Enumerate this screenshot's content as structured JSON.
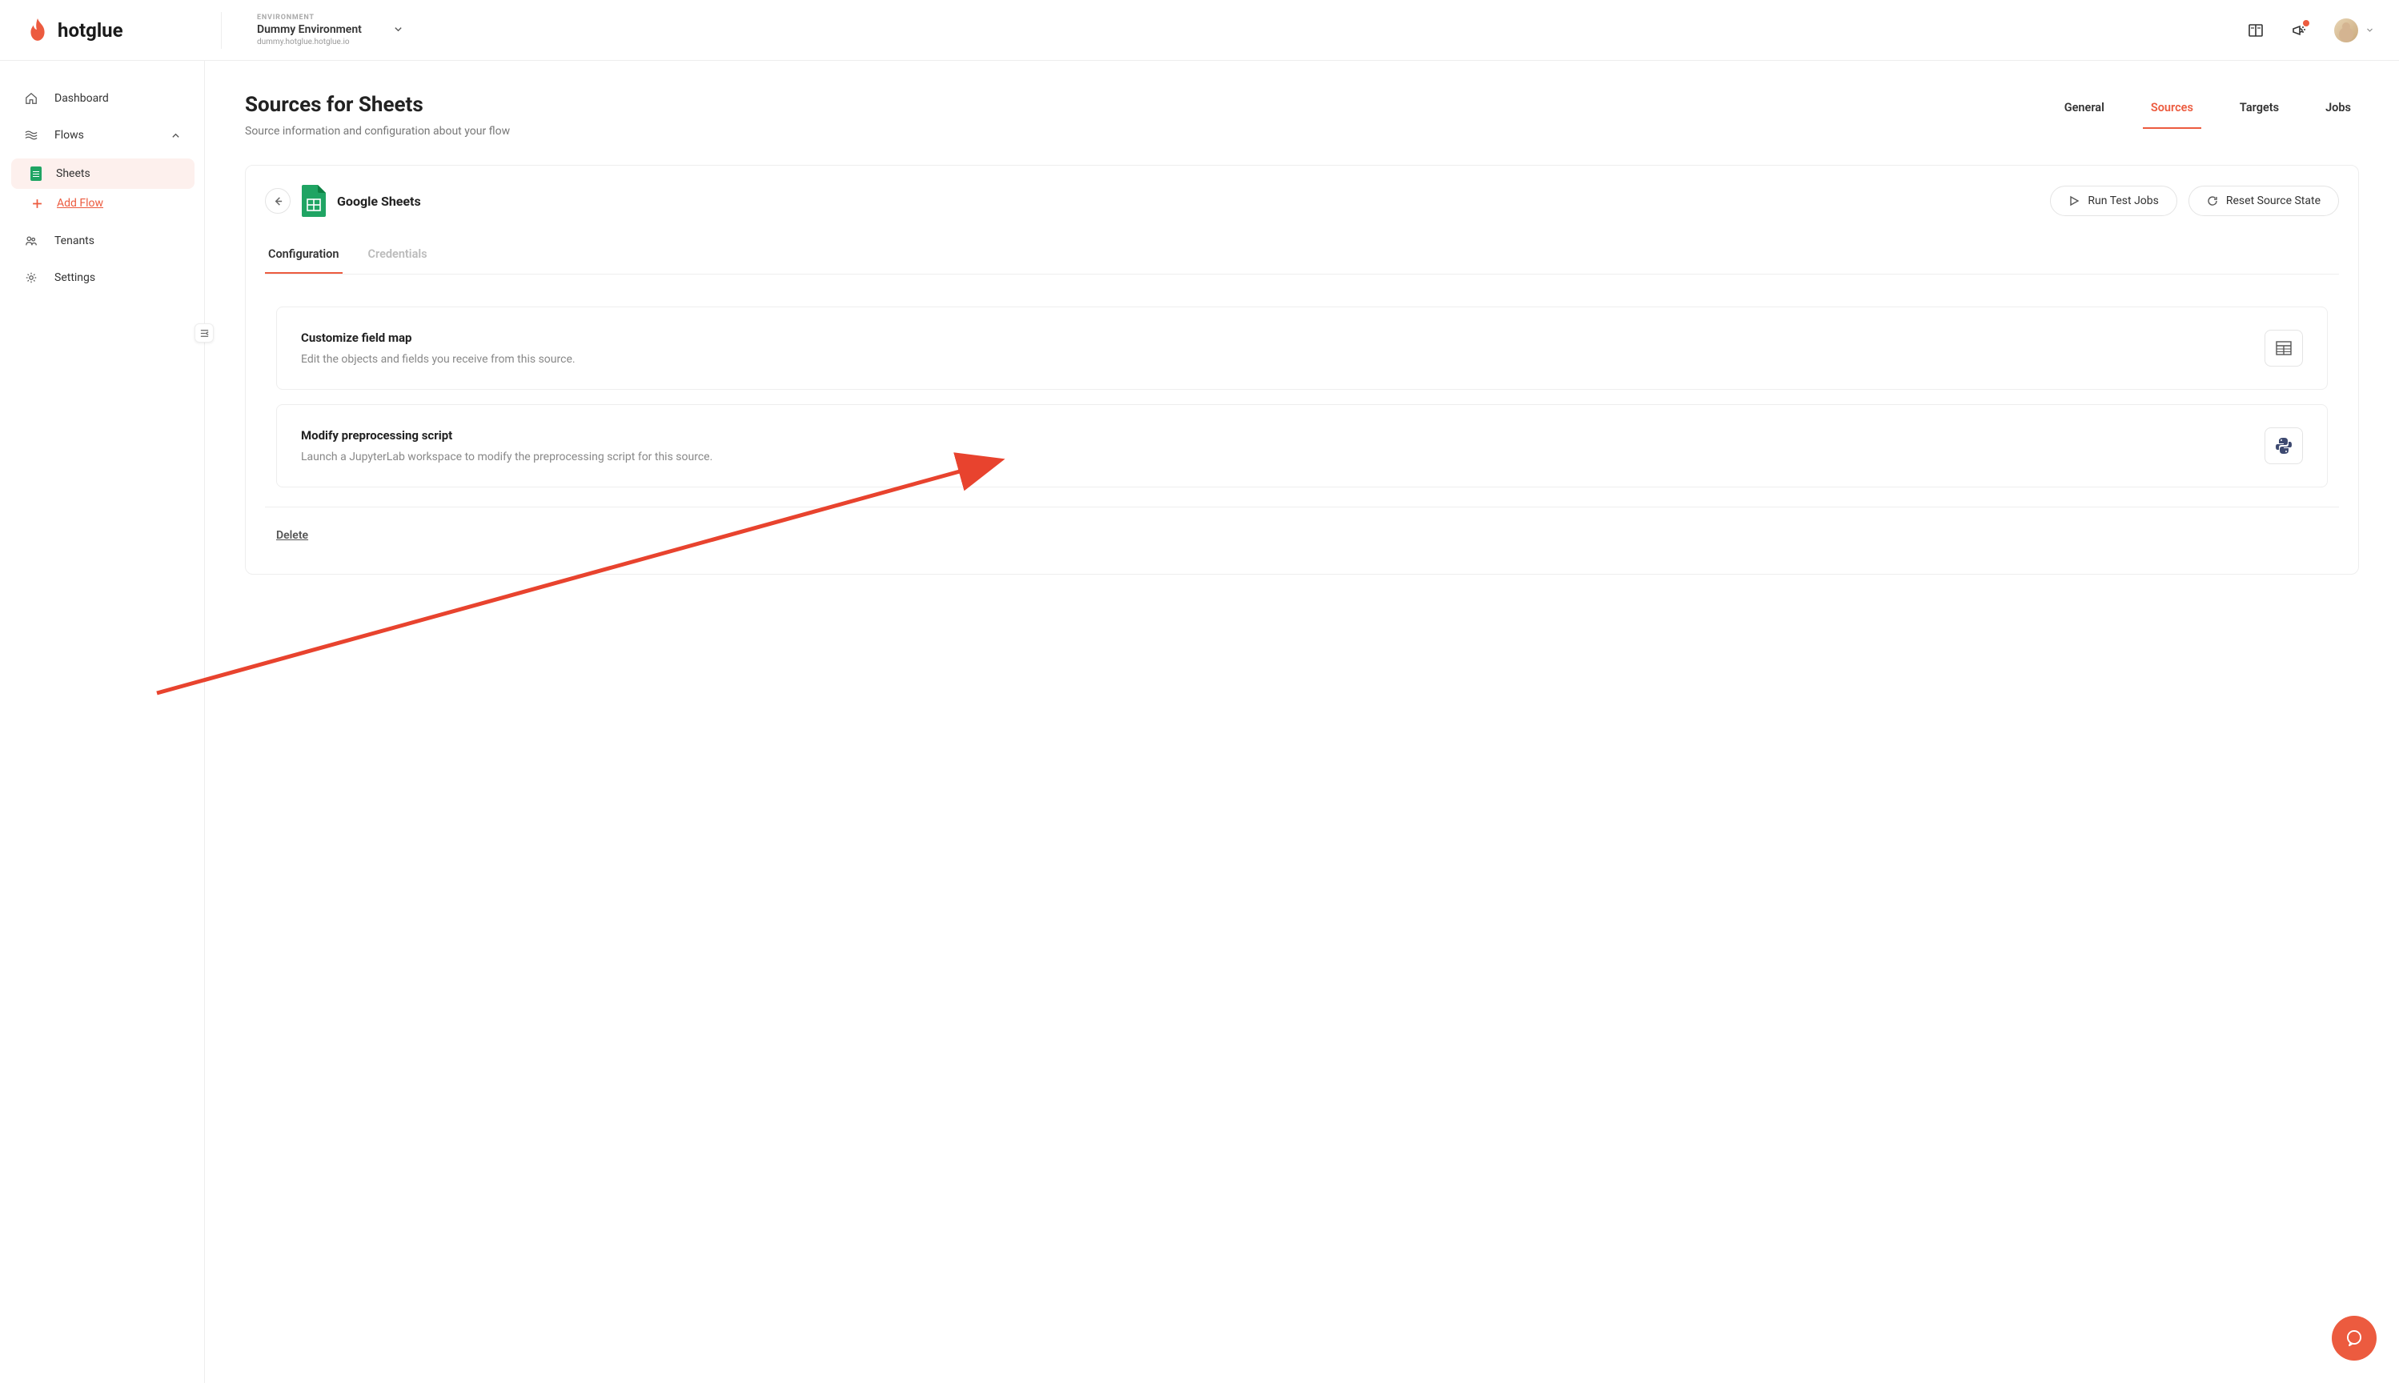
{
  "brand": {
    "name": "hotglue"
  },
  "environment": {
    "label": "ENVIRONMENT",
    "name": "Dummy Environment",
    "url": "dummy.hotglue.hotglue.io"
  },
  "sidebar": {
    "dashboard": "Dashboard",
    "flows": "Flows",
    "flow_items": [
      {
        "label": "Sheets",
        "active": true
      }
    ],
    "add_flow": "Add Flow",
    "tenants": "Tenants",
    "settings": "Settings"
  },
  "page": {
    "title": "Sources for Sheets",
    "subtitle": "Source information and configuration about your flow"
  },
  "tabs": {
    "general": "General",
    "sources": "Sources",
    "targets": "Targets",
    "jobs": "Jobs",
    "active": "sources"
  },
  "source": {
    "name": "Google Sheets",
    "actions": {
      "run_test": "Run Test Jobs",
      "reset": "Reset Source State"
    }
  },
  "inner_tabs": {
    "configuration": "Configuration",
    "credentials": "Credentials",
    "active": "configuration"
  },
  "config_items": [
    {
      "title": "Customize field map",
      "desc": "Edit the objects and fields you receive from this source.",
      "icon": "table-icon"
    },
    {
      "title": "Modify preprocessing script",
      "desc": "Launch a JupyterLab workspace to modify the preprocessing script for this source.",
      "icon": "python-icon"
    }
  ],
  "delete_label": "Delete",
  "colors": {
    "accent": "#ec5b3f",
    "green": "#1fa463"
  }
}
